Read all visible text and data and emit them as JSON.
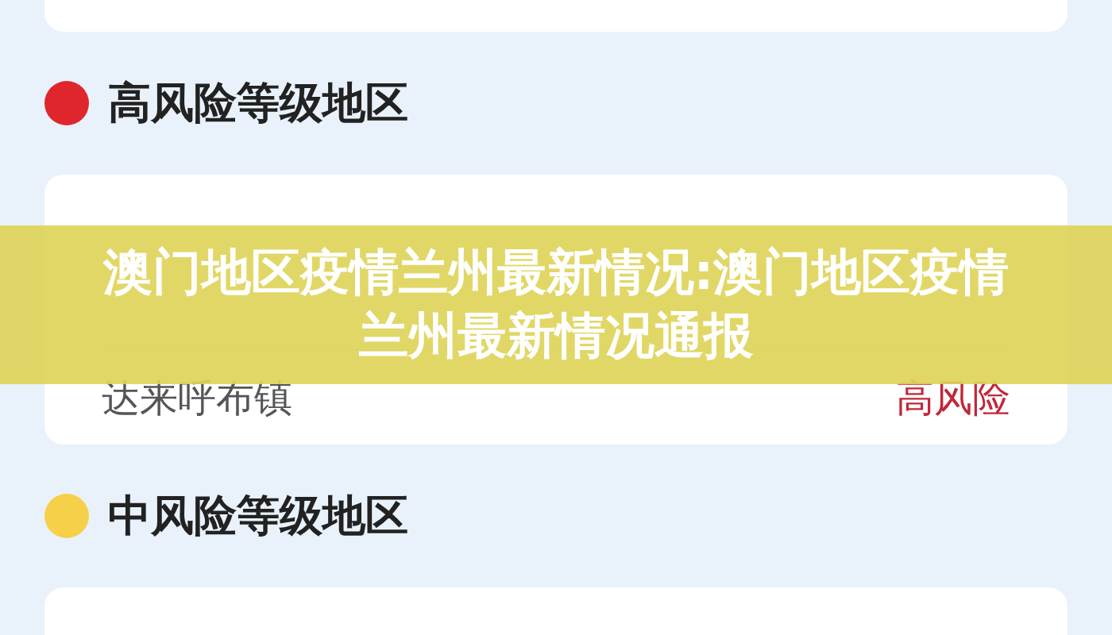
{
  "sections": [
    {
      "title": "高风险等级地区",
      "color": "#e0262d",
      "rows": [
        {
          "place": "达来呼布镇",
          "risk": "高风险",
          "color": "#c0283a"
        }
      ]
    },
    {
      "title": "中风险等级地区",
      "color": "#f7d04a"
    }
  ],
  "banner": {
    "title": "澳门地区疫情兰州最新情况:澳门地区疫情兰州最新情况通报"
  }
}
